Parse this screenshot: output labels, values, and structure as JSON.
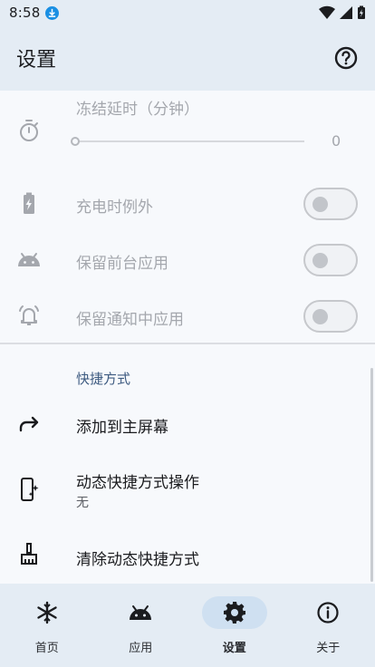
{
  "status_bar": {
    "time": "8:58"
  },
  "app_bar": {
    "title": "设置"
  },
  "freeze_delay": {
    "label": "冻结延时（分钟）",
    "value": "0",
    "slider_fraction": 0
  },
  "settings": [
    {
      "label": "充电时例外",
      "enabled": false
    },
    {
      "label": "保留前台应用",
      "enabled": false
    },
    {
      "label": "保留通知中应用",
      "enabled": false
    }
  ],
  "shortcuts": {
    "section_title": "快捷方式",
    "add_to_home": "添加到主屏幕",
    "dynamic_action_title": "动态快捷方式操作",
    "dynamic_action_value": "无",
    "clear_dynamic": "清除动态快捷方式"
  },
  "nav": [
    {
      "label": "首页",
      "icon": "snowflake-icon"
    },
    {
      "label": "应用",
      "icon": "android-icon"
    },
    {
      "label": "设置",
      "icon": "gear-icon",
      "active": true
    },
    {
      "label": "关于",
      "icon": "info-icon"
    }
  ],
  "colors": {
    "accent": "#3d5a80",
    "bar_bg": "#e4ecf4",
    "active_pill": "#cfe0f1"
  }
}
